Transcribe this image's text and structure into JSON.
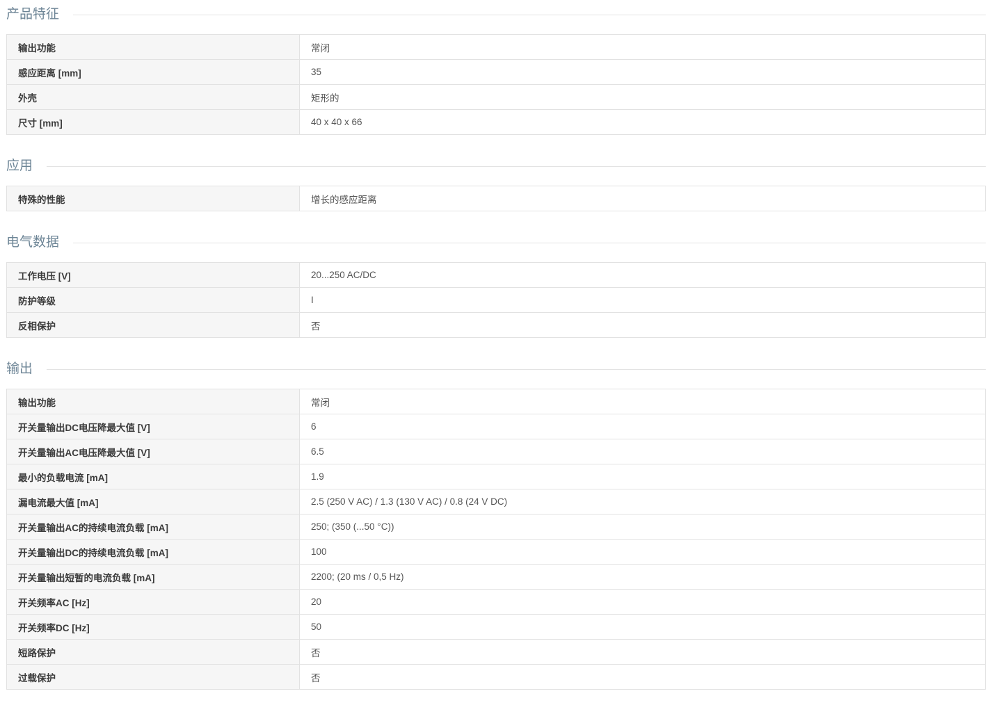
{
  "sections": [
    {
      "title": "产品特征",
      "rows": [
        {
          "label": "输出功能",
          "value": "常闭"
        },
        {
          "label": "感应距离 [mm]",
          "value": "35"
        },
        {
          "label": "外壳",
          "value": "矩形的"
        },
        {
          "label": "尺寸 [mm]",
          "value": "40 x 40 x 66"
        }
      ]
    },
    {
      "title": "应用",
      "rows": [
        {
          "label": "特殊的性能",
          "value": "增长的感应距离"
        }
      ]
    },
    {
      "title": "电气数据",
      "rows": [
        {
          "label": "工作电压 [V]",
          "value": "20...250 AC/DC"
        },
        {
          "label": "防护等级",
          "value": "I"
        },
        {
          "label": "反相保护",
          "value": "否"
        }
      ]
    },
    {
      "title": "输出",
      "rows": [
        {
          "label": "输出功能",
          "value": "常闭"
        },
        {
          "label": "开关量输出DC电压降最大值 [V]",
          "value": "6"
        },
        {
          "label": "开关量输出AC电压降最大值 [V]",
          "value": "6.5"
        },
        {
          "label": "最小的负载电流 [mA]",
          "value": "1.9"
        },
        {
          "label": "漏电流最大值 [mA]",
          "value": "2.5 (250 V AC) / 1.3 (130 V AC) / 0.8 (24 V DC)"
        },
        {
          "label": "开关量输出AC的持续电流负载 [mA]",
          "value": "250; (350 (...50 °C))"
        },
        {
          "label": "开关量输出DC的持续电流负载 [mA]",
          "value": "100"
        },
        {
          "label": "开关量输出短暂的电流负载 [mA]",
          "value": "2200; (20 ms / 0,5 Hz)"
        },
        {
          "label": "开关频率AC [Hz]",
          "value": "20"
        },
        {
          "label": "开关频率DC [Hz]",
          "value": "50"
        },
        {
          "label": "短路保护",
          "value": "否"
        },
        {
          "label": "过载保护",
          "value": "否"
        }
      ]
    }
  ]
}
